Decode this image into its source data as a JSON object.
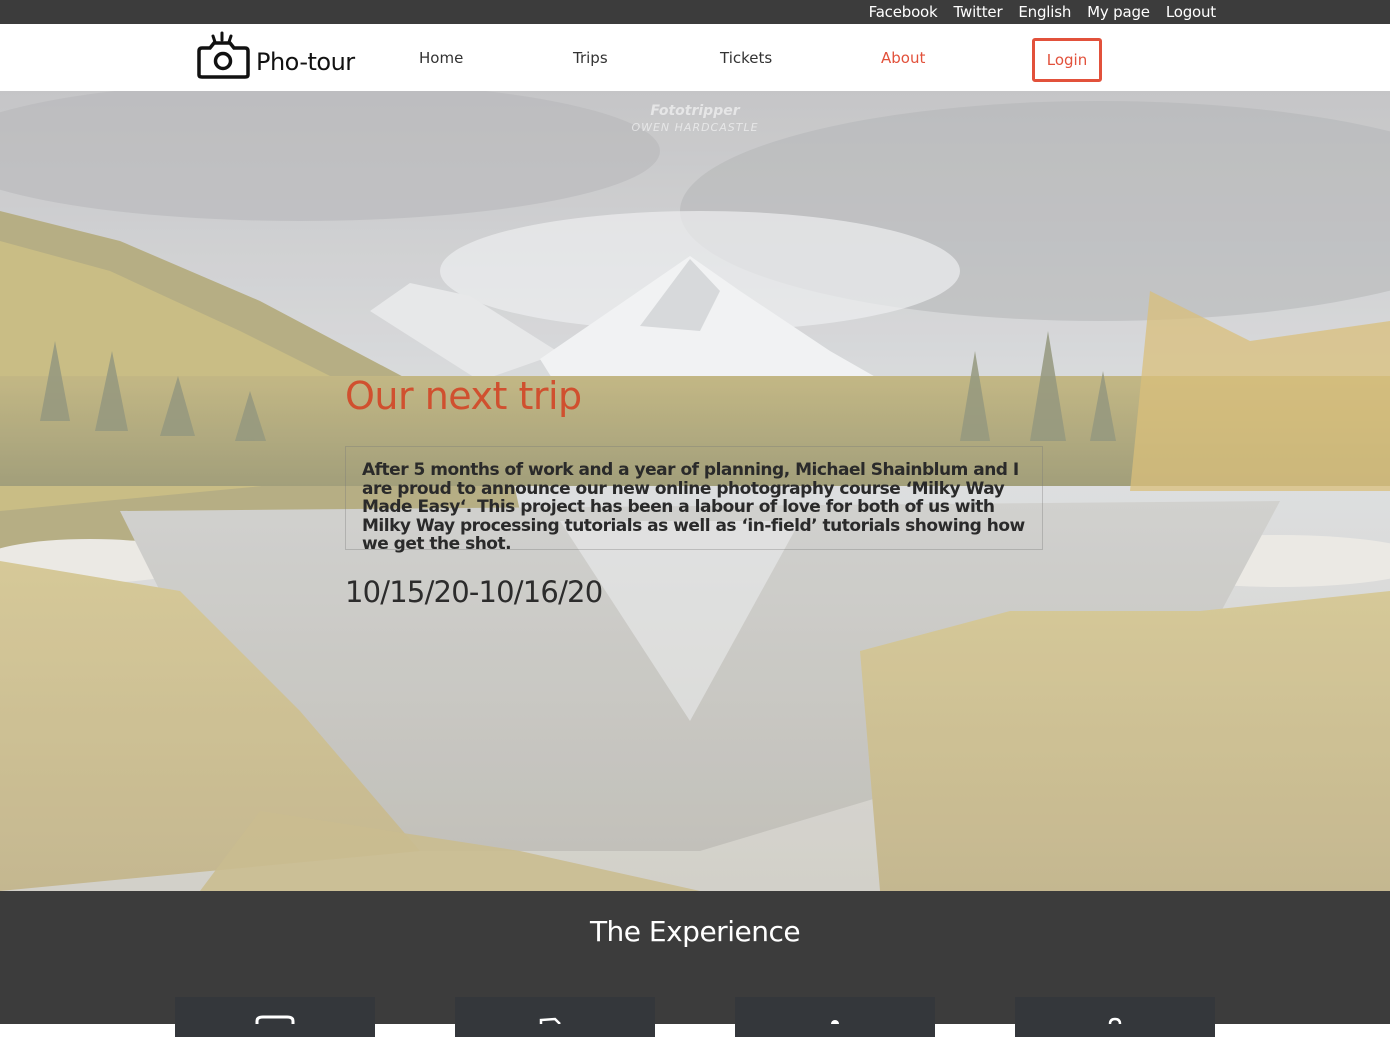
{
  "topbar": {
    "links": [
      "Facebook",
      "Twitter",
      "English",
      "My page",
      "Logout"
    ]
  },
  "navbar": {
    "brand": "Pho-tour",
    "items": [
      "Home",
      "Trips",
      "Tickets",
      "About"
    ],
    "active": "About",
    "login_label": "Login"
  },
  "hero": {
    "watermark_line1": "Fototripper",
    "watermark_line2": "OWEN HARDCASTLE",
    "title": "Our next trip",
    "description": "After 5 months of work and a year of planning, Michael Shainblum and I are proud to announce our new online photography course ‘Milky Way Made Easy‘. This project has been a labour of love for both of us with Milky Way processing tutorials as well as ‘in-field’ tutorials showing how we get the shot.",
    "dates": "10/15/20-10/16/20"
  },
  "experience": {
    "title": "The Experience",
    "cards": [
      {
        "icon": "camera-icon"
      },
      {
        "icon": "flag-icon"
      },
      {
        "icon": "person-icon"
      },
      {
        "icon": "map-pin-icon"
      }
    ]
  },
  "colors": {
    "accent": "#e2513b",
    "title": "#d0502f",
    "dark_bar": "#3c3c3c",
    "card": "#34373b"
  }
}
